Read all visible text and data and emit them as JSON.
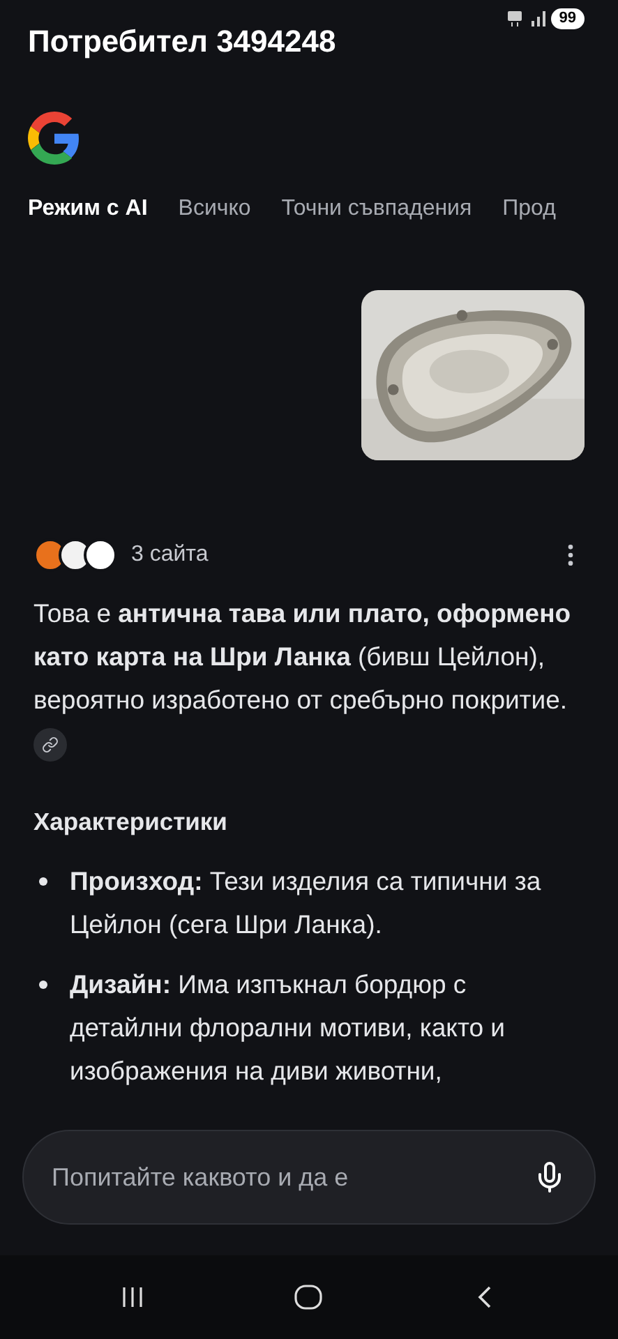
{
  "status_bar": {
    "battery": "99"
  },
  "header": {
    "title": "Потребител 3494248"
  },
  "tabs": [
    {
      "label": "Режим с AI",
      "selected": true
    },
    {
      "label": "Всичко",
      "selected": false
    },
    {
      "label": "Точни съвпадения",
      "selected": false
    },
    {
      "label": "Прод",
      "selected": false
    }
  ],
  "answer": {
    "sources_label": "3 сайта",
    "sources": [
      {
        "color": "#e8711c"
      },
      {
        "color": "#f2f2f2"
      },
      {
        "color": "#ffffff"
      }
    ],
    "intro": "Това е **антична тава или плато, оформено като карта на Шри Ланка** (бивш Цейлон), вероятно изработено от сребърно покритие.",
    "heading": "Характеристики",
    "bullets": [
      {
        "term": "Произход:",
        "text": "Тези изделия са типични за Цейлон (сега Шри Ланка)."
      },
      {
        "term": "Дизайн:",
        "text": "Има изпъкнал бордюр с детайлни флорални мотиви, както и изображения на диви животни,"
      }
    ]
  },
  "search": {
    "placeholder": "Попитайте каквото и да е"
  }
}
